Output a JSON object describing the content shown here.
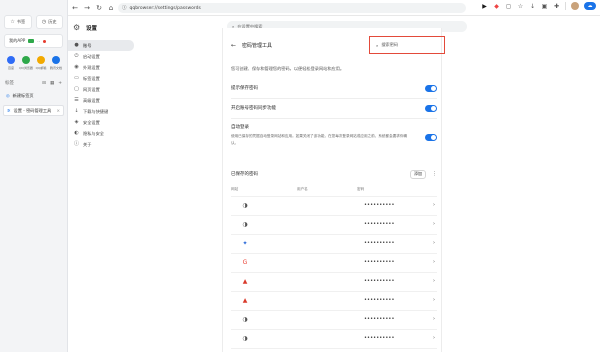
{
  "sidebar": {
    "btn_left": "书签",
    "btn_right": "历史",
    "wide_btn": "我的APP",
    "apps": [
      {
        "label": "百度",
        "color": "#2f6cf6"
      },
      {
        "label": "QQ浏览器",
        "color": "#2ea84a"
      },
      {
        "label": "QQ邮箱",
        "color": "#f2a900"
      },
      {
        "label": "腾讯文档",
        "color": "#1a73e8"
      }
    ],
    "tabs_label": "标签",
    "tab_items": [
      {
        "label": "新建标签页"
      },
      {
        "label": "设置 - 密码管理工具"
      }
    ]
  },
  "toolbar": {
    "url": "qqbrowser://settings/passwords"
  },
  "settings": {
    "title": "设置",
    "search_placeholder": "在设置中搜索",
    "nav": [
      {
        "label": "账号",
        "icon": "user-icon",
        "glyph": "●"
      },
      {
        "label": "启动设置",
        "icon": "power-icon",
        "glyph": "⏻"
      },
      {
        "label": "外观设置",
        "icon": "palette-icon",
        "glyph": "◉"
      },
      {
        "label": "标签设置",
        "icon": "tab-icon",
        "glyph": "▭"
      },
      {
        "label": "网页设置",
        "icon": "web-icon",
        "glyph": "▢"
      },
      {
        "label": "高级设置",
        "icon": "advanced-icon",
        "glyph": "☰"
      },
      {
        "label": "下载与快捷键",
        "icon": "download-icon",
        "glyph": "↓"
      },
      {
        "label": "安全设置",
        "icon": "shield-icon",
        "glyph": "◈"
      },
      {
        "label": "隐私与安全",
        "icon": "privacy-icon",
        "glyph": "◐"
      },
      {
        "label": "关于",
        "icon": "info-icon",
        "glyph": "ⓘ"
      }
    ]
  },
  "passwords": {
    "title": "密码管理工具",
    "search_placeholder": "搜索密码",
    "description": "您可创建、保存和管理您的密码，以便轻松登录网站和应用。",
    "offer_save": "提示保存密码",
    "sync_feature": "开启账号密码同步功能",
    "auto_signin_title": "自动登录",
    "auto_signin_desc": "使用已保存的凭据自动登录网站和应用。如果关闭了该功能，在您每次登录网站或应用之前，系统都会要求你确认。",
    "saved_title": "已保存的密码",
    "add_label": "添加",
    "columns": {
      "site": "网站",
      "username": "用户名",
      "password": "密码"
    },
    "entries": [
      {
        "favicon": "globe-icon",
        "glyph": "◑",
        "color": "#555555",
        "masked": "••••••••••"
      },
      {
        "favicon": "globe-icon",
        "glyph": "◑",
        "color": "#555555",
        "masked": "••••••••••"
      },
      {
        "favicon": "star-icon",
        "glyph": "✦",
        "color": "#2b6ad8",
        "masked": "••••••••••"
      },
      {
        "favicon": "google-icon",
        "glyph": "G",
        "color": "#ea4335",
        "masked": "••••••••••"
      },
      {
        "favicon": "mascot-icon",
        "glyph": "▲",
        "color": "#d93a2b",
        "masked": "••••••••••"
      },
      {
        "favicon": "mascot-icon",
        "glyph": "▲",
        "color": "#d93a2b",
        "masked": "••••••••••"
      },
      {
        "favicon": "globe-icon",
        "glyph": "◑",
        "color": "#555555",
        "masked": "••••••••••"
      },
      {
        "favicon": "globe-icon",
        "glyph": "◑",
        "color": "#555555",
        "masked": "••••••••••"
      },
      {
        "favicon": "globe-icon",
        "glyph": "◑",
        "color": "#555555",
        "masked": "••••••••••"
      }
    ]
  },
  "colors": {
    "accent": "#1a73e8",
    "highlight_border": "#e34a3a"
  }
}
